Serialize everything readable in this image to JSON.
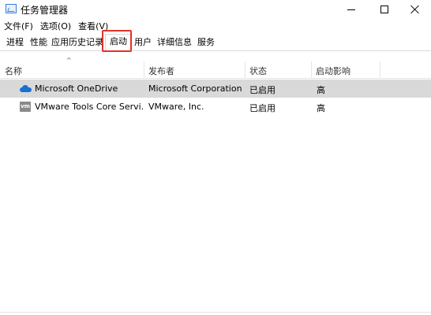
{
  "window": {
    "title": "任务管理器"
  },
  "menu": [
    {
      "label": "文件(F)"
    },
    {
      "label": "选项(O)"
    },
    {
      "label": "查看(V)"
    }
  ],
  "tabs": [
    {
      "label": "进程"
    },
    {
      "label": "性能"
    },
    {
      "label": "应用历史记录"
    },
    {
      "label": "启动",
      "active": true
    },
    {
      "label": "用户"
    },
    {
      "label": "详细信息"
    },
    {
      "label": "服务"
    }
  ],
  "table": {
    "sort_indicator": "^",
    "columns": [
      "名称",
      "发布者",
      "状态",
      "启动影响"
    ],
    "rows": [
      {
        "icon": "onedrive-icon",
        "name": "Microsoft OneDrive",
        "publisher": "Microsoft Corporation",
        "status": "已启用",
        "impact": "高",
        "selected": true
      },
      {
        "icon": "vmware-icon",
        "icon_text": "vm",
        "name": "VMware Tools Core Servi...",
        "publisher": "VMware, Inc.",
        "status": "已启用",
        "impact": "高",
        "selected": false
      }
    ]
  },
  "colors": {
    "highlight_border": "#e0332a",
    "selected_row": "#d9d9d9",
    "onedrive_blue": "#1a6fd1"
  }
}
